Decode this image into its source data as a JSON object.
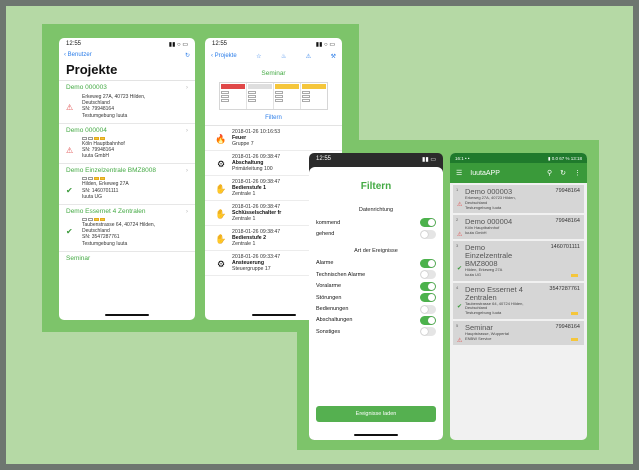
{
  "phone1": {
    "time": "12:55",
    "signal": "▮▮ ○ ▭",
    "back_label": "Benutzer",
    "title": "Projekte",
    "projects": [
      {
        "name": "Demo 000003",
        "lines": [
          "Erkeweg 27A, 40723 Hilden,",
          "Deutschland",
          "SN: 79948164",
          "Testumgebung Iuuta"
        ]
      },
      {
        "name": "Demo 000004",
        "lines": [
          "Köln Hauptbahnhof",
          "SN: 79948164",
          "Iuuta GmbH"
        ]
      },
      {
        "name": "Demo Einzelzentrale BMZ8008",
        "lines": [
          "Hilden, Erkeweg 27A",
          "SN: 1460701111",
          "Iuuta UG"
        ]
      },
      {
        "name": "Demo Essernet 4 Zentralen",
        "lines": [
          "Taubenstrasse 64, 40724 Hilden,",
          "Deutschland",
          "SN: 3547287761",
          "Testumgebung Iuuta"
        ]
      }
    ],
    "partial_item": "Seminar"
  },
  "phone2": {
    "time": "12:55",
    "back_label": "Projekte",
    "seminar": "Seminar",
    "legend_headers": [
      "Feuer",
      "gestört",
      "Störung",
      "Abschaltung"
    ],
    "filter_label": "Filtern",
    "events": [
      {
        "icon": "fire-icon",
        "glyph": "🔥",
        "date": "2018-01-26 10:16:53",
        "title": "Feuer",
        "sub": "Gruppe 7"
      },
      {
        "icon": "gear-icon",
        "glyph": "⚙",
        "date": "2018-01-26 09:38:47",
        "title": "Abschaltung",
        "sub": "Primärleitung 100"
      },
      {
        "icon": "hand-icon",
        "glyph": "✋",
        "date": "2018-01-26 09:38:47",
        "title": "Bedienstufe 1",
        "sub": "Zentrale 1"
      },
      {
        "icon": "hand-icon",
        "glyph": "✋",
        "date": "2018-01-26 09:38:47",
        "title": "Schlüsselschalter fr",
        "sub": "Zentrale 1"
      },
      {
        "icon": "hand-icon",
        "glyph": "✋",
        "date": "2018-01-26 09:38:47",
        "title": "Bedienstufe 2",
        "sub": "Zentrale 1"
      },
      {
        "icon": "gear-icon",
        "glyph": "⚙",
        "date": "2018-01-26 09:33:47",
        "title": "Ansteuerung",
        "sub": "Steuergruppe 17"
      }
    ]
  },
  "phone3": {
    "time": "12:55",
    "title": "Filtern",
    "section1": "Datenrichtung",
    "direction": [
      {
        "label": "kommend",
        "on": true
      },
      {
        "label": "gehend",
        "on": false
      }
    ],
    "section2": "Art der Ereignisse",
    "types": [
      {
        "label": "Alarme",
        "on": true
      },
      {
        "label": "Technischen Alarme",
        "on": false
      },
      {
        "label": "Voralarme",
        "on": true
      },
      {
        "label": "Störungen",
        "on": true
      },
      {
        "label": "Bedienungen",
        "on": false
      },
      {
        "label": "Abschaltungen",
        "on": true
      },
      {
        "label": "Sonstiges",
        "on": false
      }
    ],
    "button": "Ereignisse laden"
  },
  "phone4": {
    "status_left": "16:1 • •",
    "status_right": "▮ 0.0 67 % 13:18",
    "app_title": "IuutaAPP",
    "cards": [
      {
        "idx": "1",
        "name": [
          "Demo 000003"
        ],
        "num": "79948164",
        "lines": [
          "Erkeweg 27A, 40723 Hilden,",
          "Deutschland",
          "Testumgebung Iuuta"
        ],
        "mark": "⚠",
        "markcolor": "#e05050"
      },
      {
        "idx": "2",
        "name": [
          "Demo 000004"
        ],
        "num": "79948164",
        "lines": [
          "Köln Hauptbahnhof",
          "Iuuta GmbH"
        ],
        "mark": "⚠",
        "markcolor": "#e05050"
      },
      {
        "idx": "3",
        "name": [
          "Demo",
          "Einzelzentrale",
          "BMZ8008"
        ],
        "num": "1460701111",
        "lines": [
          "Hilden, Erkeweg 27A",
          "Iuuta UG"
        ],
        "mark": "✔",
        "markcolor": "#3a9a3a"
      },
      {
        "idx": "4",
        "name": [
          "Demo Essernet 4",
          "Zentralen"
        ],
        "num": "3547287761",
        "lines": [
          "Taubenstrasse 64, 40724 Hilden,",
          "Deutschland",
          "Testumgebung Iuuta"
        ],
        "mark": "✔",
        "markcolor": "#3a9a3a"
      },
      {
        "idx": "5",
        "name": [
          "Seminar"
        ],
        "num": "79948164",
        "lines": [
          "Hauptstrasse, Wuppertal",
          "ENBW Service"
        ],
        "mark": "⚠",
        "markcolor": "#e05050"
      }
    ]
  },
  "colors": {
    "accent_green": "#44aa44",
    "frame_green": "#7dc46a",
    "toggle_on": "#4cb24c",
    "app_bar": "#3a9a3a"
  }
}
